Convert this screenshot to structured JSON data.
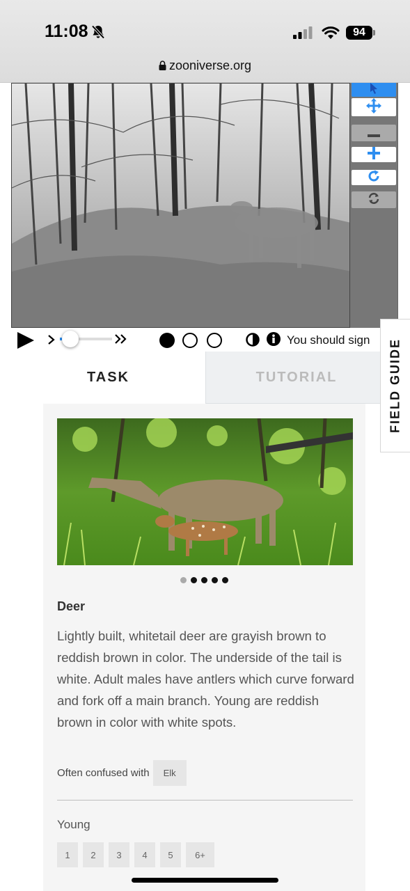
{
  "status_bar": {
    "time": "11:08",
    "battery": "94",
    "url": "zooniverse.org"
  },
  "viewer": {
    "tools": [
      "pointer-icon",
      "move-icon",
      "zoom-out-icon",
      "zoom-in-icon",
      "rotate-icon",
      "reset-icon"
    ],
    "frames": [
      "frame-1",
      "frame-2",
      "frame-3"
    ],
    "current_frame": 1,
    "playback_speed_fraction": 0.2,
    "sign_in_message": "You should sign"
  },
  "tabs": {
    "task": "TASK",
    "tutorial": "TUTORIAL"
  },
  "field_guide": {
    "label": "FIELD GUIDE"
  },
  "species_card": {
    "image_count": 5,
    "active_image": 1,
    "name": "Deer",
    "description": "Lightly built, whitetail deer are grayish brown to reddish brown in color. The underside of the tail is white. Adult males have antlers which curve forward and fork off a main branch. Young are reddish brown in color with white spots.",
    "confused_label": "Often confused with",
    "confused_with": [
      "Elk"
    ],
    "young_label": "Young",
    "young_options": [
      "1",
      "2",
      "3",
      "4",
      "5",
      "6+"
    ]
  },
  "colors": {
    "accent": "#2e8ef0",
    "tab_inactive_text": "#bbbbbb",
    "panel_bg": "#f5f5f5"
  }
}
